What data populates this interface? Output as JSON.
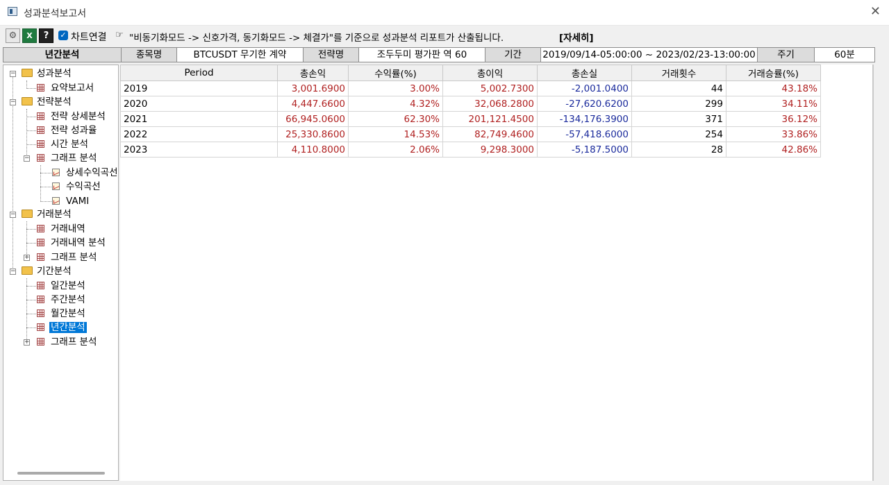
{
  "window": {
    "title": "성과분석보고서"
  },
  "toolbar": {
    "chart_link_label": "차트연결",
    "notice": "\"비동기화모드 -> 신호가격, 동기화모드 -> 체결가\"를 기준으로 성과분석 리포트가 산출됩니다.",
    "detail_label": "[자세히]"
  },
  "infobar": {
    "current": "년간분석",
    "symbol_label": "종목명",
    "symbol_value": "BTCUSDT 무기한 계약",
    "strategy_label": "전략명",
    "strategy_value": "조두두미 평가판 역 60",
    "period_label": "기간",
    "period_value": "2019/09/14-05:00:00 ~ 2023/02/23-13:00:00",
    "cycle_label": "주기",
    "cycle_value": "60분"
  },
  "tree": {
    "perf": "성과분석",
    "summary": "요약보고서",
    "strategy": "전략분석",
    "strategy_detail": "전략 상세분석",
    "strategy_perf": "전략 성과율",
    "time_analysis": "시간 분석",
    "graph_analysis": "그래프 분석",
    "detail_curve": "상세수익곡선",
    "profit_curve": "수익곡선",
    "vami": "VAMI",
    "trade": "거래분석",
    "trade_list": "거래내역",
    "trade_list_analysis": "거래내역 분석",
    "trade_graph": "그래프 분석",
    "period": "기간분석",
    "daily": "일간분석",
    "weekly": "주간분석",
    "monthly": "월간분석",
    "yearly": "년간분석",
    "period_graph": "그래프 분석"
  },
  "table": {
    "headers": [
      "Period",
      "총손익",
      "수익률(%)",
      "총이익",
      "총손실",
      "거래횟수",
      "거래승률(%)"
    ],
    "rows": [
      [
        "2019",
        "3,001.6900",
        "3.00%",
        "5,002.7300",
        "-2,001.0400",
        "44",
        "43.18%"
      ],
      [
        "2020",
        "4,447.6600",
        "4.32%",
        "32,068.2800",
        "-27,620.6200",
        "299",
        "34.11%"
      ],
      [
        "2021",
        "66,945.0600",
        "62.30%",
        "201,121.4500",
        "-134,176.3900",
        "371",
        "36.12%"
      ],
      [
        "2022",
        "25,330.8600",
        "14.53%",
        "82,749.4600",
        "-57,418.6000",
        "254",
        "33.86%"
      ],
      [
        "2023",
        "4,110.8000",
        "2.06%",
        "9,298.3000",
        "-5,187.5000",
        "28",
        "42.86%"
      ]
    ]
  },
  "colors": {
    "positive": "#b02020",
    "negative": "#1a2a9c",
    "selection": "#0078d7"
  }
}
